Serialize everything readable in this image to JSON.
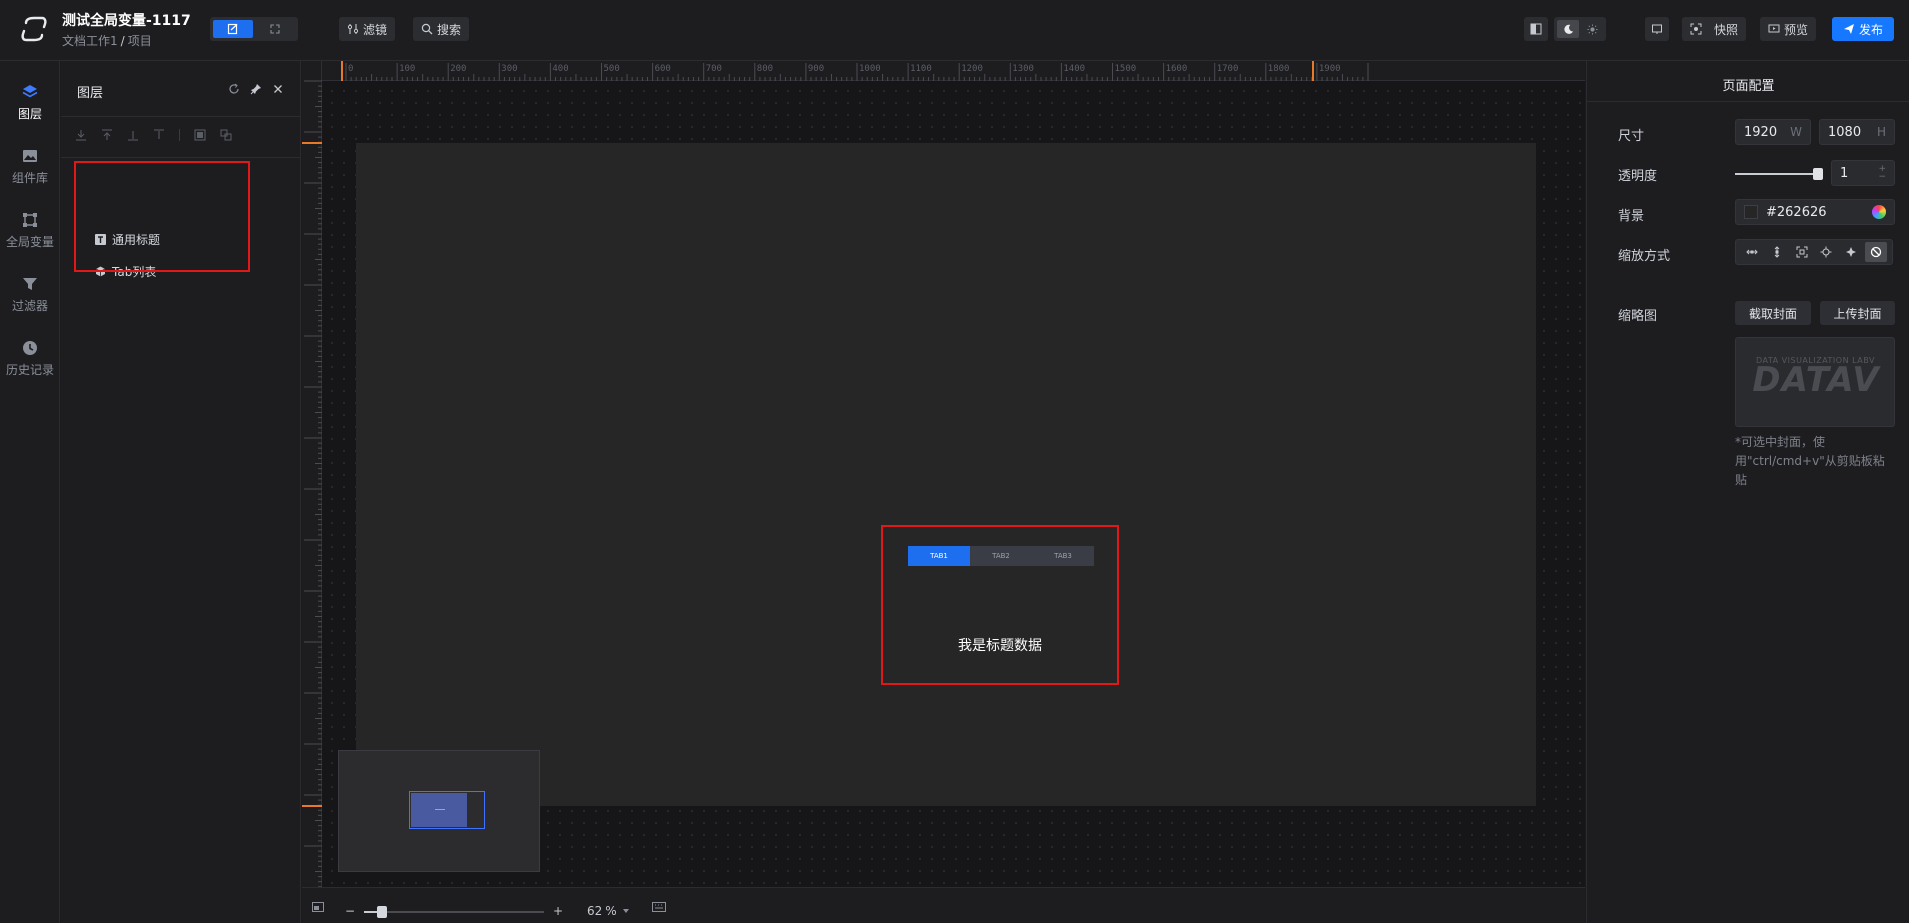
{
  "header": {
    "project_title": "测试全局变量-1117",
    "breadcrumb": {
      "workspace": "文档工作1",
      "sep": "/",
      "project": "项目"
    },
    "filter_label": "滤镜",
    "search_label": "搜索",
    "snapshot_label": "快照",
    "preview_label": "预览",
    "publish_label": "发布"
  },
  "leftnav": {
    "items": [
      {
        "label": "图层",
        "icon": "layers-icon"
      },
      {
        "label": "组件库",
        "icon": "component-library-icon"
      },
      {
        "label": "全局变量",
        "icon": "global-variable-icon"
      },
      {
        "label": "过滤器",
        "icon": "filter-icon"
      },
      {
        "label": "历史记录",
        "icon": "history-icon"
      }
    ]
  },
  "layers": {
    "title": "图层",
    "items": [
      {
        "label": "通用标题",
        "icon": "text-icon"
      },
      {
        "label": "Tab列表",
        "icon": "cube-icon"
      }
    ]
  },
  "canvas": {
    "ruler_labels": [
      "0",
      "100",
      "200",
      "300",
      "400",
      "500",
      "600",
      "700",
      "800",
      "900",
      "1000",
      "1100",
      "1200",
      "1300",
      "1400",
      "1500",
      "1600",
      "1700",
      "1800",
      "1900"
    ],
    "component": {
      "tabs": [
        "TAB1",
        "TAB2",
        "TAB3"
      ],
      "title": "我是标题数据"
    }
  },
  "bottombar": {
    "zoom_minus": "−",
    "zoom_plus": "+",
    "zoom_value": "62",
    "zoom_unit": "%",
    "zoom_fraction": 0.1
  },
  "rightpanel": {
    "title": "页面配置",
    "size_label": "尺寸",
    "width_value": "1920",
    "width_suffix": "W",
    "height_value": "1080",
    "height_suffix": "H",
    "opacity_label": "透明度",
    "opacity_value": "1",
    "background_label": "背景",
    "background_value": "#262626",
    "scale_label": "缩放方式",
    "thumbnail_label": "缩略图",
    "capture_cover_label": "截取封面",
    "upload_cover_label": "上传封面",
    "thumb_small_text": "DATA VISUALIZATION LABV",
    "thumb_big_text": "DATAV",
    "hint": "*可选中封面，使用\"ctrl/cmd+v\"从剪贴板粘贴"
  },
  "colors": {
    "accent": "#1677ff",
    "highlight_border": "#e01818",
    "artboard": "#262626"
  }
}
